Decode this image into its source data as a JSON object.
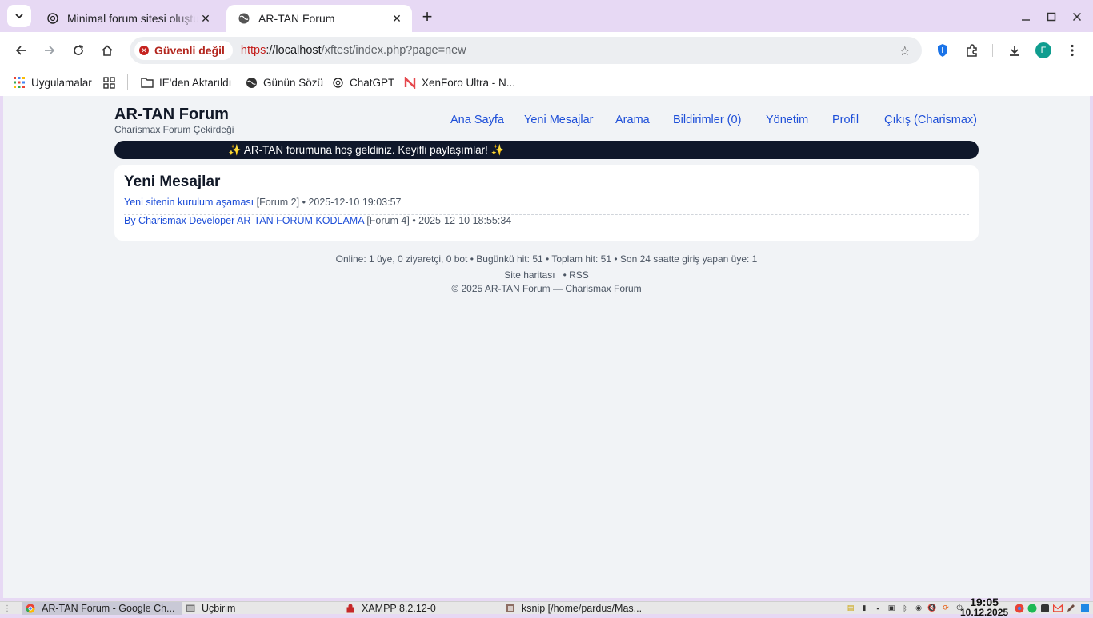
{
  "browser": {
    "tabs": [
      {
        "title": "Minimal forum sitesi oluştur",
        "active": false
      },
      {
        "title": "AR-TAN Forum",
        "active": true
      }
    ],
    "security_chip": "Güvenli değil",
    "url": {
      "scheme": "https",
      "host": "://localhost",
      "path": "/xftest/index.php?page=new"
    },
    "profile_initial": "F",
    "bookmarks": [
      {
        "label": "Uygulamalar",
        "icon": "apps-grid-icon"
      },
      {
        "label": "IE'den Aktarıldı",
        "icon": "folder-icon"
      },
      {
        "label": "Günün Sözü",
        "icon": "globe-icon"
      },
      {
        "label": "ChatGPT",
        "icon": "chatgpt-icon"
      },
      {
        "label": "XenForo Ultra - N...",
        "icon": "n-logo-icon"
      }
    ]
  },
  "site": {
    "title": "AR-TAN Forum",
    "subtitle": "Charismax Forum Çekirdeği",
    "nav": [
      "Ana Sayfa",
      "Yeni Mesajlar",
      "Arama",
      "Bildirimler (0)",
      "Yönetim",
      "Profil",
      "Çıkış (Charismax)"
    ],
    "banner": "✨ AR-TAN forumuna hoş geldiniz. Keyifli paylaşımlar! ✨",
    "panel": {
      "heading": "Yeni Mesajlar",
      "posts": [
        {
          "title": "Yeni sitenin kurulum aşaması",
          "forum": "[Forum 2]",
          "meta": "• 2025-12-10 19:03:57"
        },
        {
          "title": "By Charismax Developer AR-TAN FORUM KODLAMA",
          "forum": "[Forum 4]",
          "meta": "• 2025-12-10 18:55:34"
        }
      ]
    },
    "footer": {
      "stats": "Online: 1 üye, 0 ziyaretçi, 0 bot • Bugünkü hit: 51 • Toplam hit: 51 • Son 24 saatte giriş yapan üye: 1",
      "sitemap": "Site haritası",
      "rss": "• RSS",
      "copyright": "© 2025 AR-TAN Forum — Charismax Forum"
    }
  },
  "taskbar": {
    "tasks": [
      {
        "label": "AR-TAN Forum - Google Ch...",
        "active": true
      },
      {
        "label": "Uçbirim",
        "active": false
      },
      {
        "label": "XAMPP 8.2.12-0",
        "active": false
      },
      {
        "label": "ksnip [/home/pardus/Mas...",
        "active": false
      }
    ],
    "time": "19:05",
    "date": "10.12.2025"
  },
  "colors": {
    "accent_link": "#1d4ed8",
    "banner_bg": "#0f172a",
    "tabstrip": "#e7d9f4",
    "insecure": "#c5221f"
  }
}
